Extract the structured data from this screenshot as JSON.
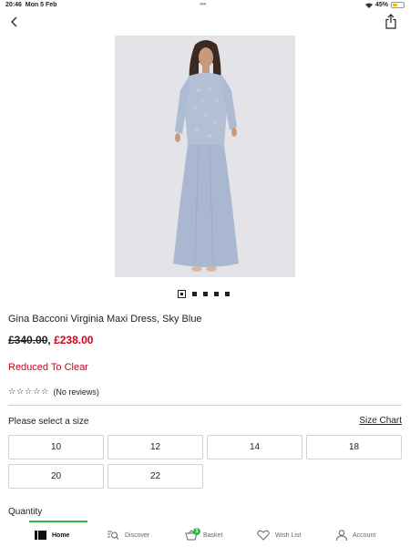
{
  "status_bar": {
    "time": "20:46",
    "date": "Mon 5 Feb",
    "battery": "45%",
    "battery_level": 0.45,
    "dots": "•••"
  },
  "product": {
    "title": "Gina Bacconi Virginia Maxi Dress, Sky Blue",
    "price_old": "£340.00",
    "price_separator": ",",
    "price_new": "£238.00",
    "promo": "Reduced To Clear",
    "rating_stars": "☆☆☆☆☆",
    "reviews": "(No reviews)",
    "image_count": 5,
    "image_current": 1
  },
  "sizes": {
    "label": "Please select a size",
    "chart_link": "Size Chart",
    "options": [
      "10",
      "12",
      "14",
      "18",
      "20",
      "22"
    ]
  },
  "quantity": {
    "label": "Quantity"
  },
  "tabs": [
    {
      "label": "Home",
      "icon": "home-icon",
      "active": true
    },
    {
      "label": "Discover",
      "icon": "discover-icon",
      "active": false
    },
    {
      "label": "Basket",
      "icon": "basket-icon",
      "active": false,
      "badge": "1"
    },
    {
      "label": "Wish List",
      "icon": "heart-icon",
      "active": false
    },
    {
      "label": "Account",
      "icon": "account-icon",
      "active": false
    }
  ],
  "colors": {
    "accent_green": "#2db84a",
    "sale_red": "#d0021b",
    "dress_blue": "#a9b8d0"
  }
}
